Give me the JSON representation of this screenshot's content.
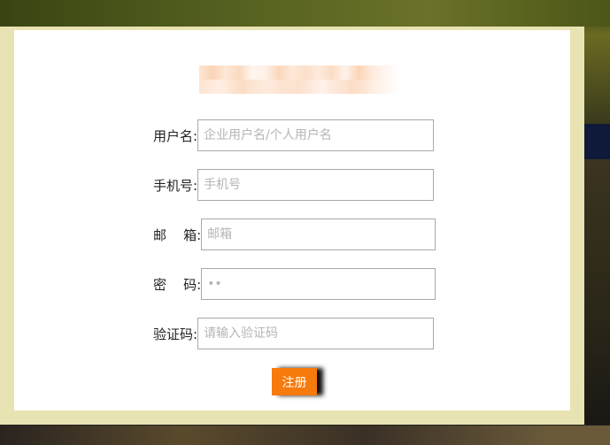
{
  "form": {
    "fields": [
      {
        "label": "用户名:",
        "placeholder": "企业用户名/个人用户名",
        "value": ""
      },
      {
        "label": "手机号:",
        "placeholder": "手机号",
        "value": ""
      },
      {
        "label": "邮    箱:",
        "placeholder": "邮箱",
        "value": ""
      },
      {
        "label": "密    码:",
        "placeholder": "",
        "value": "••"
      },
      {
        "label": "验证码:",
        "placeholder": "请输入验证码",
        "value": ""
      }
    ],
    "submit_label": "注册"
  },
  "colors": {
    "accent": "#f77a0d",
    "panel": "#ffffff",
    "frame": "#e8e3b2"
  },
  "icons": {
    "logo": "blurred-logo"
  }
}
